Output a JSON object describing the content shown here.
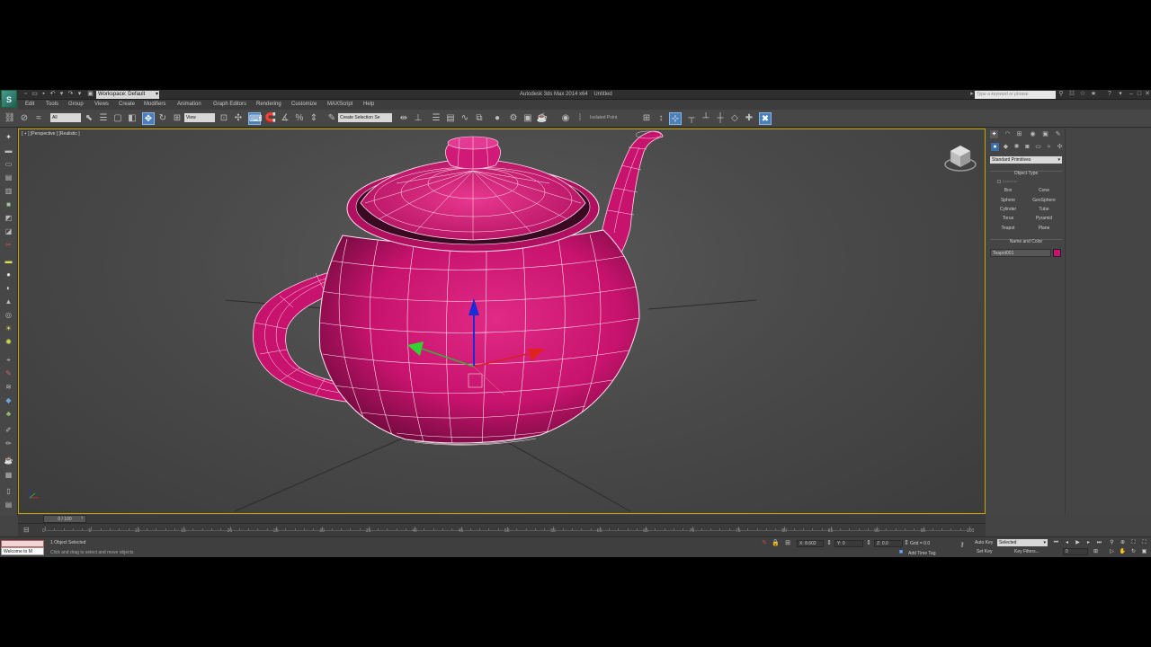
{
  "titlebar": {
    "logo": "S",
    "workspace": "Workspace: Default",
    "title": "Autodesk 3ds Max 2014 x64",
    "document": "Untitled",
    "search_placeholder": "Type a keyword or phrase"
  },
  "menu": [
    "Edit",
    "Tools",
    "Group",
    "Views",
    "Create",
    "Modifiers",
    "Animation",
    "Graph Editors",
    "Rendering",
    "Customize",
    "MAXScript",
    "Help"
  ],
  "toolbar": {
    "selection_filter": "All",
    "ref_coord": "View",
    "named_selection": "Create Selection Se",
    "isolate": "Isolated Point"
  },
  "viewport": {
    "label": "[ + ] [Perspective ] [Realistic ]",
    "object_color": "#c8136e"
  },
  "command_panel": {
    "category": "Standard Primitives",
    "object_type_title": "Object Type",
    "autogrid": "AutoGrid",
    "primitives": [
      "Box",
      "Cone",
      "Sphere",
      "GeoSphere",
      "Cylinder",
      "Tube",
      "Torus",
      "Pyramid",
      "Teapot",
      "Plane"
    ],
    "name_color_title": "Name and Color",
    "object_name": "Teapot001",
    "object_color": "#c8136e"
  },
  "timeline": {
    "slider": "0 / 100",
    "frames": [
      "0",
      "5",
      "10",
      "15",
      "20",
      "25",
      "30",
      "35",
      "40",
      "45",
      "50",
      "55",
      "60",
      "65",
      "70",
      "75",
      "80",
      "85",
      "90",
      "95",
      "100"
    ]
  },
  "status": {
    "maxscript": "Welcome to M",
    "selection": "1 Object Selected",
    "prompt": "Click and drag to select and move objects",
    "x": "X: 8.602",
    "y": "Y: 0",
    "z": "Z: 0.0",
    "grid": "Grid = 0.0",
    "add_time_tag": "Add Time Tag",
    "auto_key": "Auto Key",
    "set_key": "Set Key",
    "key_mode": "Selected",
    "key_filters": "Key Filters...",
    "frame": "0"
  }
}
